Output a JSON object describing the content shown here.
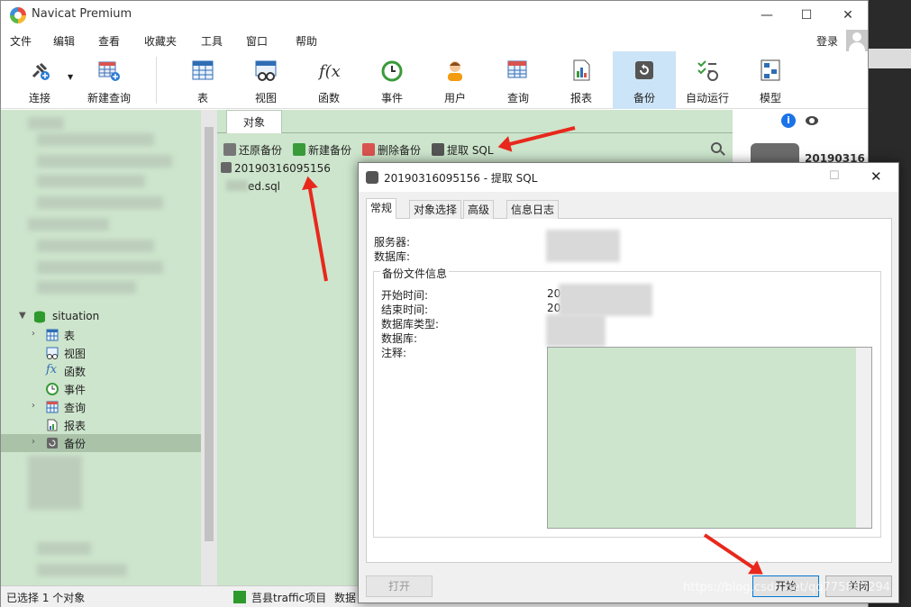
{
  "window": {
    "title": "Navicat Premium",
    "minimize": "—",
    "maximize": "☐",
    "close": "✕"
  },
  "menu": [
    "文件",
    "编辑",
    "查看",
    "收藏夹",
    "工具",
    "窗口",
    "帮助"
  ],
  "login": "登录",
  "toolbar": {
    "connect": "连接",
    "new_query": "新建查询",
    "table": "表",
    "view": "视图",
    "function": "函数",
    "event": "事件",
    "user": "用户",
    "query": "查询",
    "report": "报表",
    "backup": "备份",
    "auto_run": "自动运行",
    "model": "模型"
  },
  "sidebar": {
    "db_name": "situation",
    "items": [
      "表",
      "视图",
      "函数",
      "事件",
      "查询",
      "报表",
      "备份"
    ]
  },
  "tab": {
    "objects": "对象"
  },
  "objbar": {
    "restore": "还原备份",
    "new_backup": "新建备份",
    "delete_backup": "删除备份",
    "extract_sql": "提取 SQL"
  },
  "files": {
    "backup_name": "20190316095156",
    "sql_file": "ed.sql"
  },
  "info": {
    "name": "20190316"
  },
  "status": {
    "selected": "已选择 1 个对象",
    "connection": "莒县traffic项目",
    "db": "数据"
  },
  "dialog": {
    "title": "20190316095156 - 提取 SQL",
    "close": "✕",
    "maximize": "☐",
    "tabs": [
      "常规",
      "对象选择",
      "高级",
      "信息日志"
    ],
    "server_label": "服务器:",
    "database_label": "数据库:",
    "group_title": "备份文件信息",
    "start_time_label": "开始时间:",
    "end_time_label": "结束时间:",
    "db_type_label": "数据库类型:",
    "db_label": "数据库:",
    "notes_label": "注释:",
    "start_prefix": "20",
    "end_prefix": "20",
    "open_button": "打开",
    "start_button": "开始",
    "close_button": "关闭"
  },
  "watermark": "https://blog.csdn.net/qq775867294"
}
